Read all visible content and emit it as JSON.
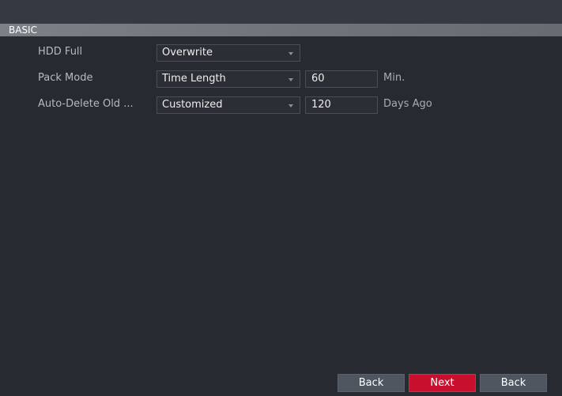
{
  "section": {
    "title": "BASIC"
  },
  "settings": {
    "hdd_full": {
      "label": "HDD Full",
      "value": "Overwrite"
    },
    "pack_mode": {
      "label": "Pack Mode",
      "value": "Time Length",
      "number": "60",
      "unit": "Min."
    },
    "auto_delete": {
      "label": "Auto-Delete Old ...",
      "value": "Customized",
      "number": "120",
      "unit": "Days Ago"
    }
  },
  "footer": {
    "back_label": "Back",
    "next_label": "Next",
    "back2_label": "Back"
  },
  "colors": {
    "accent": "#c8102e",
    "background": "#272a31"
  }
}
